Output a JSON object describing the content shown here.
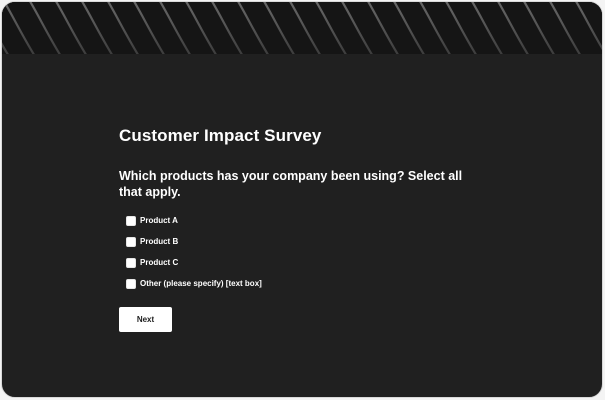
{
  "survey": {
    "title": "Customer Impact Survey",
    "question": "Which products has your company been using? Select all that apply.",
    "options": [
      {
        "label": "Product A",
        "checked": false
      },
      {
        "label": "Product B",
        "checked": false
      },
      {
        "label": "Product C",
        "checked": false
      },
      {
        "label": "Other (please specify) [text box]",
        "checked": false
      }
    ],
    "next_label": "Next"
  },
  "theme": {
    "background": "#202020",
    "banner": "#151515",
    "text": "#ffffff",
    "button_bg": "#ffffff",
    "button_text": "#1d1d1d"
  }
}
